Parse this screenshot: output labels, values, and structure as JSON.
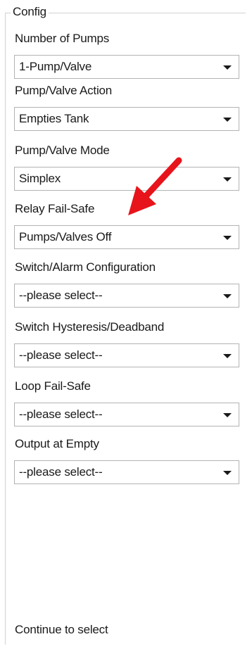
{
  "config": {
    "title": "Config",
    "fields": [
      {
        "label": "Number of Pumps",
        "value": "1-Pump/Valve"
      },
      {
        "label": "Pump/Valve Action",
        "value": "Empties Tank"
      },
      {
        "label": "Pump/Valve Mode",
        "value": "Simplex"
      },
      {
        "label": "Relay Fail-Safe",
        "value": "Pumps/Valves Off"
      },
      {
        "label": "Switch/Alarm Configuration",
        "value": "--please select--"
      },
      {
        "label": "Switch Hysteresis/Deadband",
        "value": "--please select--"
      },
      {
        "label": "Loop Fail-Safe",
        "value": "--please select--"
      },
      {
        "label": "Output at Empty",
        "value": "--please select--"
      }
    ],
    "footer": "Continue to select"
  },
  "annotation": {
    "icon": "red-arrow-icon",
    "color": "#e8141b"
  }
}
